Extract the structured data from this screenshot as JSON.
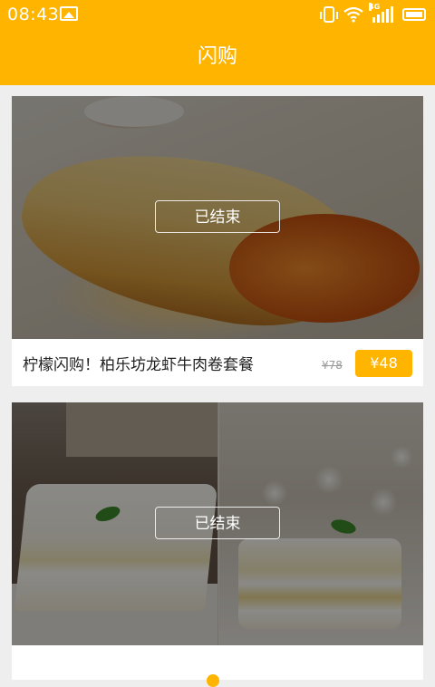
{
  "status_bar": {
    "time": "08:43",
    "network_label": "4G",
    "icons": [
      "image-icon",
      "vibrate-icon",
      "wifi-icon",
      "signal-icon",
      "battery-icon"
    ]
  },
  "header": {
    "title": "闪购"
  },
  "colors": {
    "accent": "#ffb400"
  },
  "deals": [
    {
      "title": "柠檬闪购！柏乐坊龙虾牛肉卷套餐",
      "status": "已结束",
      "original_price": "¥78",
      "price": "¥48"
    },
    {
      "status": "已结束"
    }
  ]
}
